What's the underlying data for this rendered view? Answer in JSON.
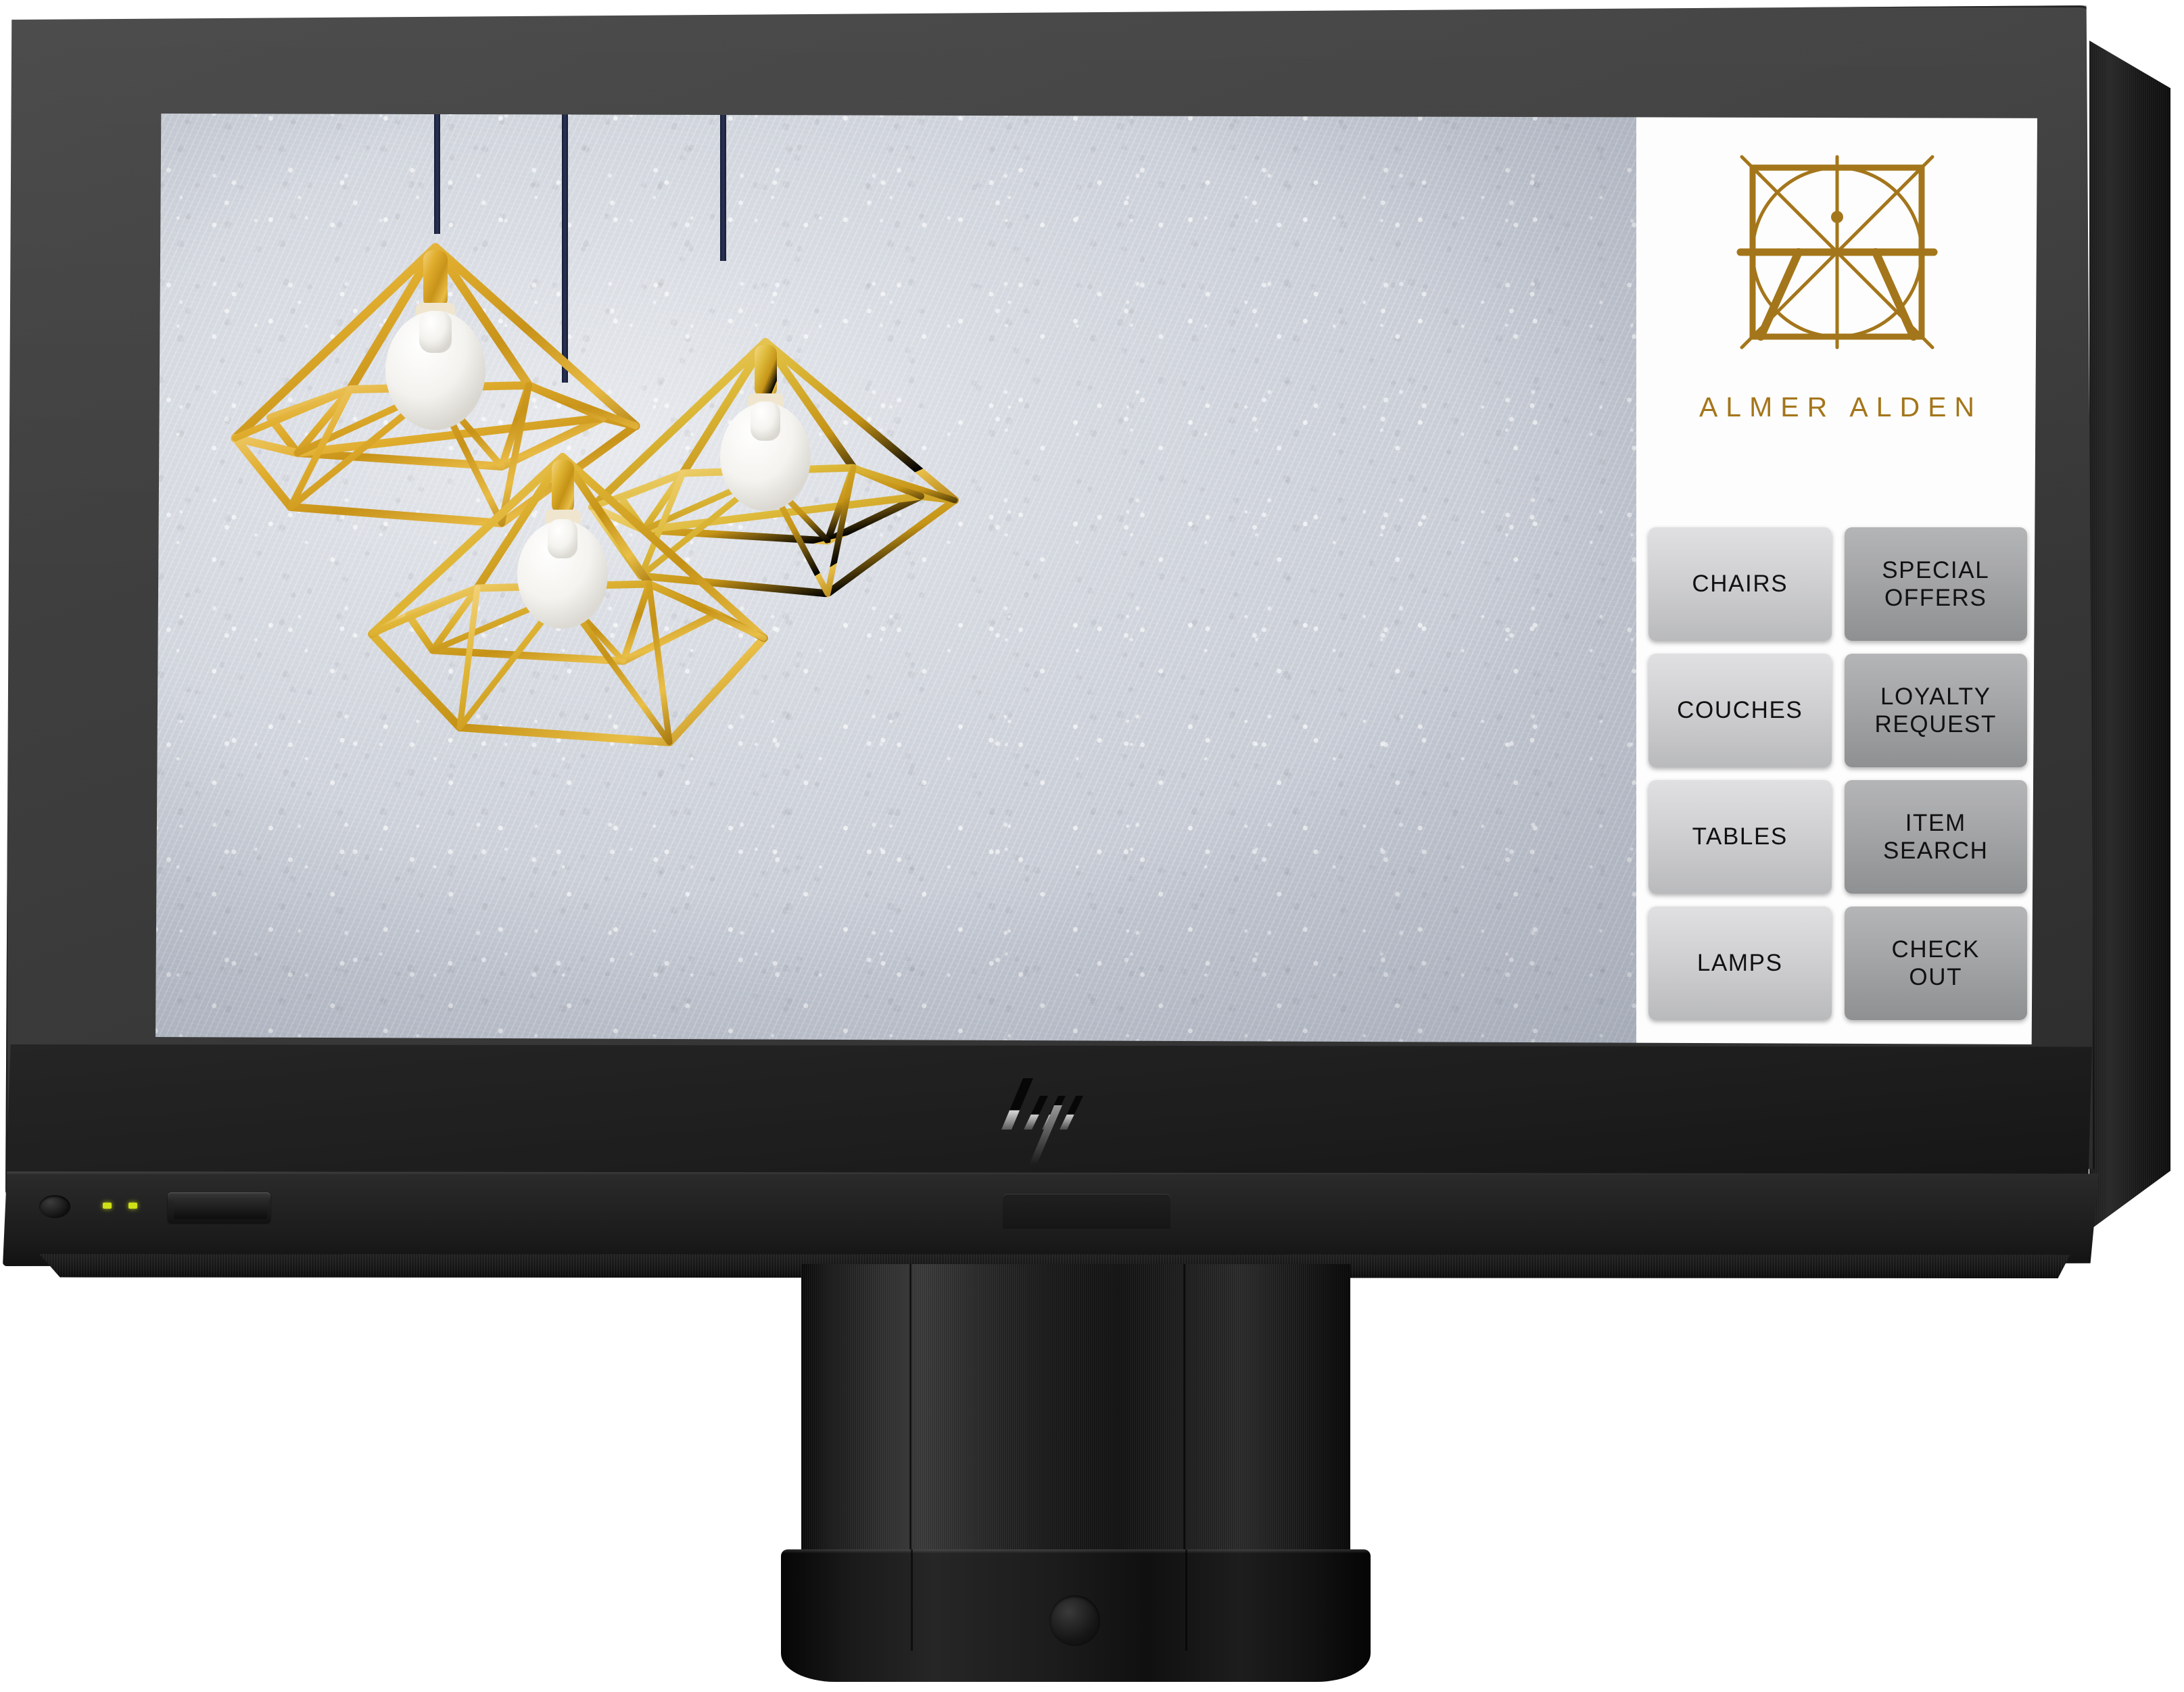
{
  "device": {
    "brand_logo": "hp-logo",
    "logo_name": "hp"
  },
  "screen": {
    "wallpaper": {
      "description": "three gold geometric cage pendant lamps hanging on a white textured plaster wall",
      "lamp_count": 3,
      "lamp_color": "#d9a820",
      "cord_color": "#1b2441",
      "bulb_color": "#fbfbfb",
      "wall_color": "#dfe2e8"
    }
  },
  "pos_panel": {
    "brand": {
      "name": "ALMER ALDEN",
      "mark_name": "almer-alden-geometric-monogram",
      "color": "#a4761b"
    },
    "buttons": [
      {
        "label": "CHAIRS",
        "name": "chairs",
        "style": "light"
      },
      {
        "label": "SPECIAL\nOFFERS",
        "name": "special-offers",
        "style": "dark"
      },
      {
        "label": "COUCHES",
        "name": "couches",
        "style": "light"
      },
      {
        "label": "LOYALTY\nREQUEST",
        "name": "loyalty-request",
        "style": "dark"
      },
      {
        "label": "TABLES",
        "name": "tables",
        "style": "light"
      },
      {
        "label": "ITEM\nSEARCH",
        "name": "item-search",
        "style": "dark"
      },
      {
        "label": "LAMPS",
        "name": "lamps",
        "style": "light"
      },
      {
        "label": "CHECK\nOUT",
        "name": "check-out",
        "style": "dark"
      }
    ]
  },
  "indicators": {
    "led_1_color": "#cfe016",
    "led_2_color": "#cfe016"
  },
  "colors": {
    "bezel": "#3d3d3d",
    "chin": "#1d1d1d",
    "panel_background": "#fdfdfd",
    "button_light_top": "#e0e0e2",
    "button_dark_top": "#b4b5b7",
    "gold": "#a4761b"
  }
}
